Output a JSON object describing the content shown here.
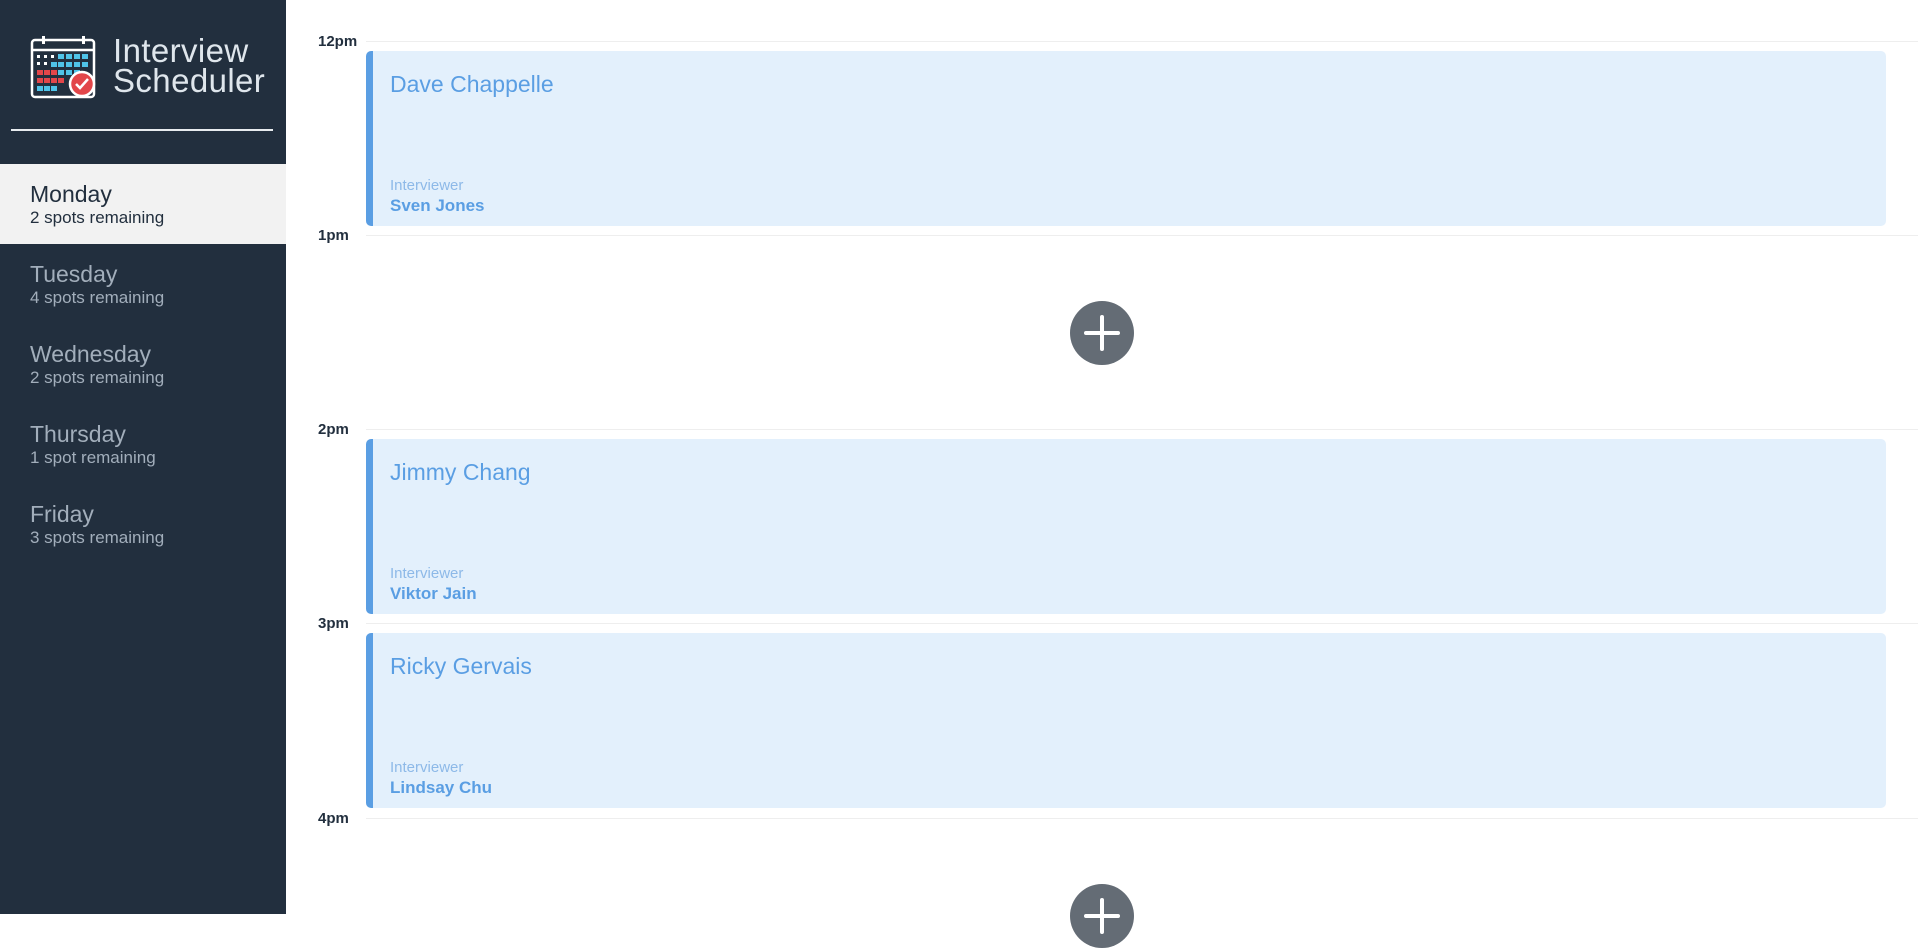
{
  "app": {
    "title_line1": "Interview",
    "title_line2": "Scheduler",
    "logo_icon": "calendar-check-icon"
  },
  "colors": {
    "sidebar_bg": "#222f3e",
    "selected_bg": "#f2f2f2",
    "accent": "#5a9ee3",
    "appointment_bg": "#e3f0fc",
    "add_button": "#646c75"
  },
  "days": [
    {
      "name": "Monday",
      "spots": "2 spots remaining",
      "selected": true
    },
    {
      "name": "Tuesday",
      "spots": "4 spots remaining",
      "selected": false
    },
    {
      "name": "Wednesday",
      "spots": "2 spots remaining",
      "selected": false
    },
    {
      "name": "Thursday",
      "spots": "1 spot remaining",
      "selected": false
    },
    {
      "name": "Friday",
      "spots": "3 spots remaining",
      "selected": false
    }
  ],
  "schedule": {
    "slots": [
      {
        "time": "12pm",
        "student": "Dave Chappelle",
        "interviewer_label": "Interviewer",
        "interviewer": "Sven Jones"
      },
      {
        "time": "1pm",
        "empty": true,
        "add_icon": "plus-circle-icon"
      },
      {
        "time": "2pm",
        "student": "Jimmy Chang",
        "interviewer_label": "Interviewer",
        "interviewer": "Viktor Jain"
      },
      {
        "time": "3pm",
        "student": "Ricky Gervais",
        "interviewer_label": "Interviewer",
        "interviewer": "Lindsay Chu"
      },
      {
        "time": "4pm",
        "empty": true,
        "add_icon": "plus-circle-icon"
      }
    ]
  }
}
